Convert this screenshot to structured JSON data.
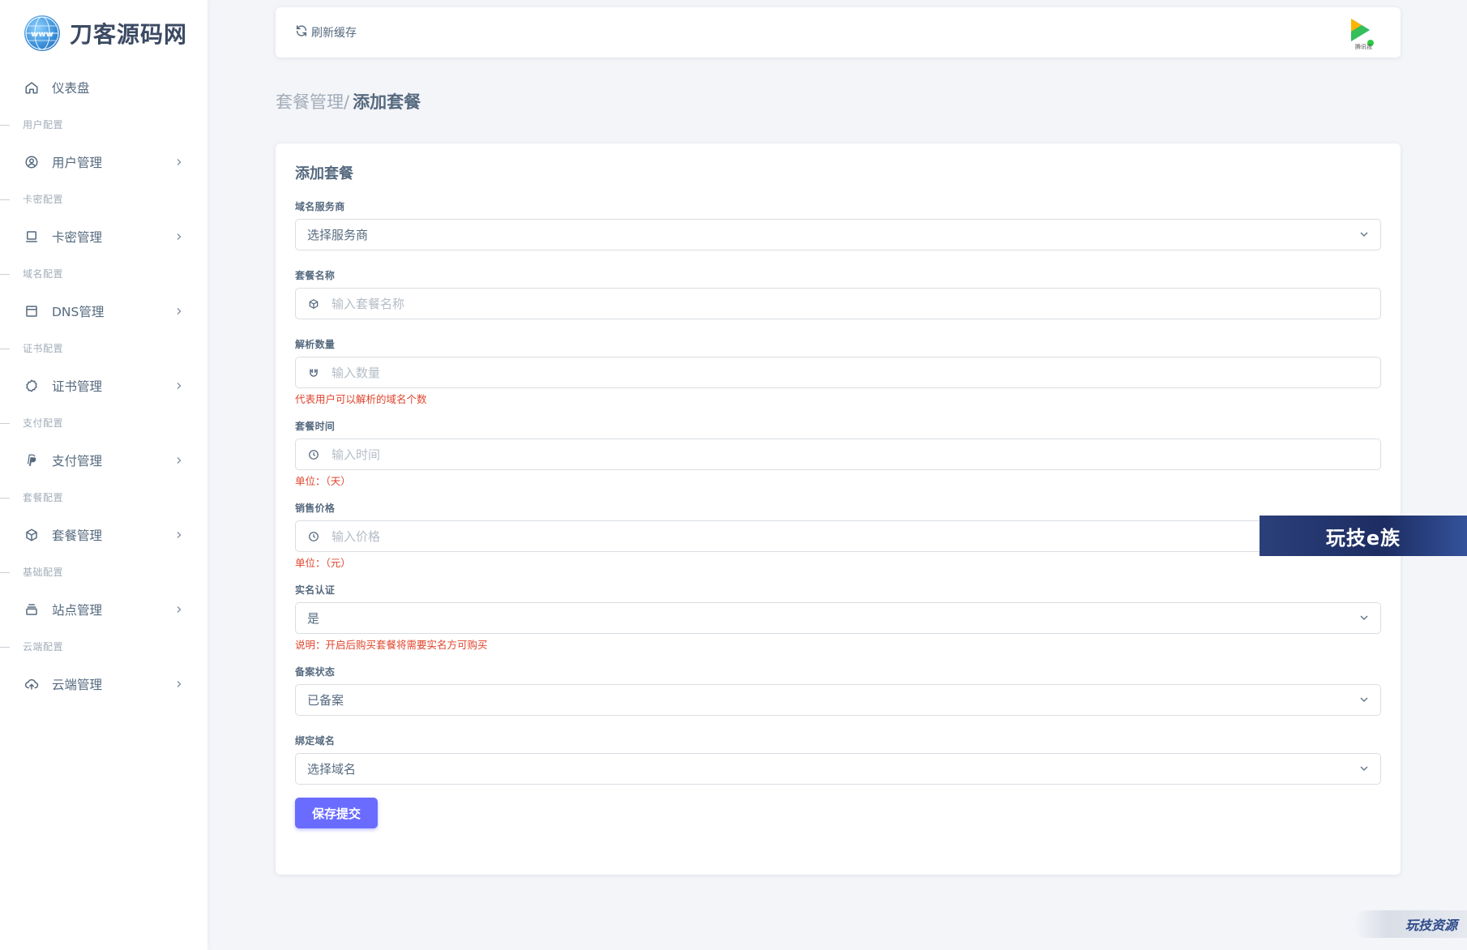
{
  "brand": {
    "name": "刀客源码网",
    "logo_icon": "globe-www-icon"
  },
  "sidebar": {
    "dashboard": {
      "label": "仪表盘",
      "icon": "home-icon"
    },
    "sections": [
      {
        "header": "用户配置",
        "label": "用户管理",
        "icon": "user-circle-icon"
      },
      {
        "header": "卡密配置",
        "label": "卡密管理",
        "icon": "laptop-icon"
      },
      {
        "header": "域名配置",
        "label": "DNS管理",
        "icon": "window-icon"
      },
      {
        "header": "证书配置",
        "label": "证书管理",
        "icon": "badge-icon"
      },
      {
        "header": "支付配置",
        "label": "支付管理",
        "icon": "paypal-icon"
      },
      {
        "header": "套餐配置",
        "label": "套餐管理",
        "icon": "package-icon"
      },
      {
        "header": "基础配置",
        "label": "站点管理",
        "icon": "archive-icon"
      },
      {
        "header": "云端配置",
        "label": "云端管理",
        "icon": "cloud-upload-icon"
      }
    ]
  },
  "navbar": {
    "refresh_label": "刷新缓存"
  },
  "breadcrumb": {
    "parent": "套餐管理",
    "separator": "/",
    "current": "添加套餐"
  },
  "form": {
    "title": "添加套餐",
    "provider": {
      "label": "域名服务商",
      "value": "选择服务商"
    },
    "package_name": {
      "label": "套餐名称",
      "placeholder": "输入套餐名称"
    },
    "resolve_count": {
      "label": "解析数量",
      "placeholder": "输入数量",
      "help": "代表用户可以解析的域名个数"
    },
    "duration": {
      "label": "套餐时间",
      "placeholder": "输入时间",
      "help": "单位：（天）"
    },
    "price": {
      "label": "销售价格",
      "placeholder": "输入价格",
      "help": "单位：（元）"
    },
    "realname": {
      "label": "实名认证",
      "value": "是",
      "help": "说明：开启后购买套餐将需要实名方可购买"
    },
    "icp_status": {
      "label": "备案状态",
      "value": "已备案"
    },
    "bind_domain": {
      "label": "绑定域名",
      "value": "选择域名"
    },
    "submit_label": "保存提交"
  },
  "watermarks": {
    "banner": "玩技e族",
    "corner": "玩技资源"
  },
  "colors": {
    "primary": "#696cff",
    "help": "#e0442c",
    "text": "#566a7f",
    "muted": "#a1acb8"
  }
}
